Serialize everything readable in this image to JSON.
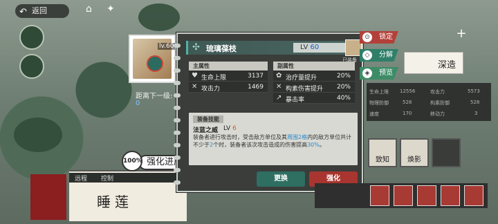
{
  "topbar": {
    "back_label": "返回",
    "back_icon": "back-arrow-icon"
  },
  "card": {
    "level": "lv.60"
  },
  "distance": {
    "label": "距离下一级:",
    "value": "0"
  },
  "strength": {
    "percent": "100%",
    "label": "强化进度"
  },
  "lotus": {
    "name": "睡莲",
    "tab1": "远程",
    "tab2": "控制"
  },
  "item": {
    "name": "琉璃葆枝",
    "level_label": "LV",
    "level": "60",
    "equipped_label": "已装备"
  },
  "main_attr": {
    "title": "主属性",
    "rows": [
      {
        "icon": "heart-icon",
        "label": "生命上限",
        "value": "3137"
      },
      {
        "icon": "swords-icon",
        "label": "攻击力",
        "value": "1469"
      }
    ]
  },
  "sub_attr": {
    "title": "副属性",
    "rows": [
      {
        "icon": "heal-icon",
        "label": "治疗量提升",
        "value": "20%"
      },
      {
        "icon": "bind-icon",
        "label": "构素伤害提升",
        "value": "20%"
      },
      {
        "icon": "crit-icon",
        "label": "暴击率",
        "value": "40%"
      }
    ]
  },
  "skill": {
    "title": "装备技能",
    "name": "法蓝之威",
    "level_label": "LV",
    "level": "6",
    "desc_1": "装备者进行攻击时，受击敌方单位及其",
    "desc_hl1": "周围2格",
    "desc_2": "内的敌方单位共计不少于",
    "desc_hl2": "2",
    "desc_3": "个时，装备者该次攻击造成的伤害提高",
    "desc_hl3": "30%",
    "desc_4": "。"
  },
  "buttons": {
    "replace": "更换",
    "enhance": "强化"
  },
  "right_actions": {
    "lock": "锁定",
    "decompose": "分解",
    "preview": "预览"
  },
  "right_tiles": {
    "deep": "深造",
    "zhizhi": "致知",
    "huanying": "焕影"
  },
  "stats": [
    {
      "label": "生命上限",
      "value": "12556"
    },
    {
      "label": "攻击力",
      "value": "5573"
    },
    {
      "label": "物理防御",
      "value": "528"
    },
    {
      "label": "构素防御",
      "value": "528"
    },
    {
      "label": "速度",
      "value": "170"
    },
    {
      "label": "移动力",
      "value": "3"
    }
  ],
  "colors": {
    "accent": "#4db3a2",
    "replace_btn": "#2e6f62",
    "enhance_btn": "#a8352f",
    "lock": "#b3403a",
    "decompose": "#2f7f69",
    "preview": "#3d8c67"
  }
}
